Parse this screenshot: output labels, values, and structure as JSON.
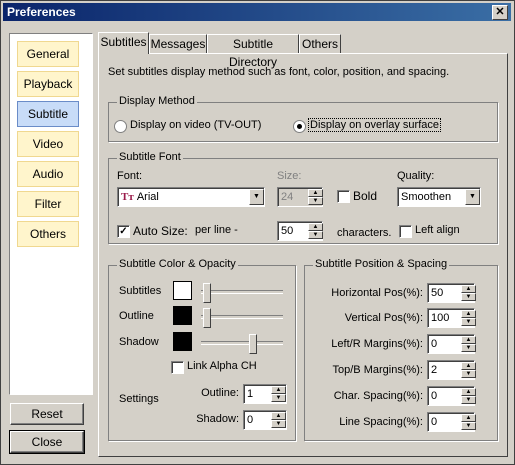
{
  "window": {
    "title": "Preferences"
  },
  "sidebar": {
    "items": [
      {
        "label": "General"
      },
      {
        "label": "Playback"
      },
      {
        "label": "Subtitle"
      },
      {
        "label": "Video"
      },
      {
        "label": "Audio"
      },
      {
        "label": "Filter"
      },
      {
        "label": "Others"
      }
    ],
    "active": "Subtitle"
  },
  "buttons": {
    "reset": "Reset",
    "close": "Close"
  },
  "tabs": [
    {
      "label": "Subtitles"
    },
    {
      "label": "Messages"
    },
    {
      "label": "Subtitle Directory"
    },
    {
      "label": "Others"
    }
  ],
  "description": "Set subtitles display method such as font, color, position, and spacing.",
  "display_method": {
    "title": "Display Method",
    "option1": "Display on video (TV-OUT)",
    "option2": "Display on overlay surface",
    "selected": "option2"
  },
  "font": {
    "title": "Subtitle Font",
    "font_label": "Font:",
    "font_value": "Arial",
    "size_label": "Size:",
    "size_value": "24",
    "bold_label": "Bold",
    "quality_label": "Quality:",
    "quality_value": "Smoothen",
    "autosize_label": "Auto Size:",
    "perline_label": "per line -",
    "perline_value": "50",
    "characters_label": "characters.",
    "leftalign_label": "Left align"
  },
  "color": {
    "title": "Subtitle Color & Opacity",
    "subtitles_label": "Subtitles",
    "outline_label": "Outline",
    "shadow_label": "Shadow",
    "subtitles_color": "#ffffff",
    "outline_color": "#000000",
    "shadow_color": "#000000",
    "link_alpha_label": "Link Alpha CH",
    "settings_label": "Settings",
    "outline_setting_label": "Outline:",
    "outline_setting_value": "1",
    "shadow_setting_label": "Shadow:",
    "shadow_setting_value": "0"
  },
  "position": {
    "title": "Subtitle Position & Spacing",
    "fields": [
      {
        "label": "Horizontal Pos(%):",
        "value": "50"
      },
      {
        "label": "Vertical Pos(%):",
        "value": "100"
      },
      {
        "label": "Left/R Margins(%):",
        "value": "0"
      },
      {
        "label": "Top/B Margins(%):",
        "value": "2"
      },
      {
        "label": "Char. Spacing(%):",
        "value": "0"
      },
      {
        "label": "Line Spacing(%):",
        "value": "0"
      }
    ]
  }
}
